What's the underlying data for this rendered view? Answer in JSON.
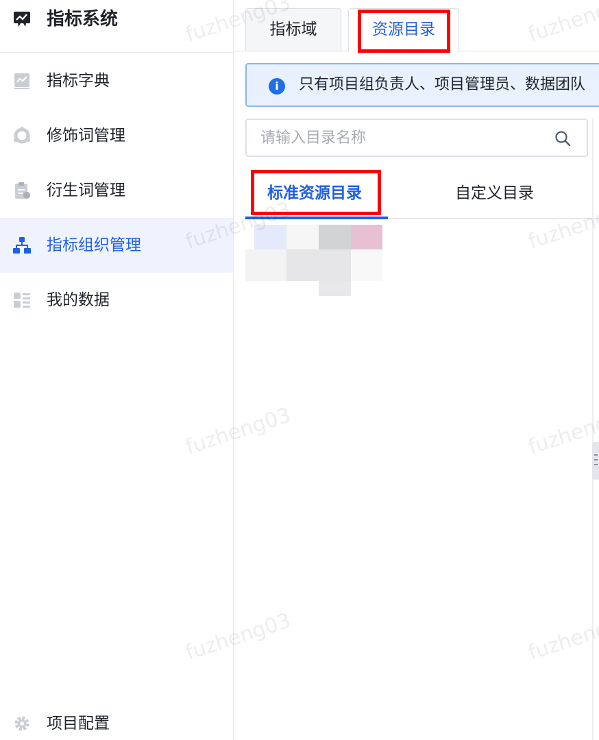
{
  "app": {
    "title": "指标系统"
  },
  "sidebar": {
    "items": [
      {
        "label": "指标字典",
        "icon": "chart-book-icon"
      },
      {
        "label": "修饰词管理",
        "icon": "ring-icon"
      },
      {
        "label": "衍生词管理",
        "icon": "clipboard-icon"
      },
      {
        "label": "指标组织管理",
        "icon": "org-tree-icon",
        "active": true
      },
      {
        "label": "我的数据",
        "icon": "grid-list-icon"
      }
    ],
    "footer": {
      "label": "项目配置",
      "icon": "gear-icon"
    }
  },
  "top_tabs": [
    {
      "label": "指标域"
    },
    {
      "label": "资源目录",
      "active": true
    }
  ],
  "alert": {
    "text": "只有项目组负责人、项目管理员、数据团队"
  },
  "search": {
    "placeholder": "请输入目录名称"
  },
  "sub_tabs": [
    {
      "label": "标准资源目录",
      "active": true
    },
    {
      "label": "自定义目录"
    }
  ],
  "watermark": "fuzheng03",
  "colors": {
    "accent": "#1f5fe0",
    "highlight": "#ff0000",
    "alert_bg": "#e9f1fe"
  }
}
